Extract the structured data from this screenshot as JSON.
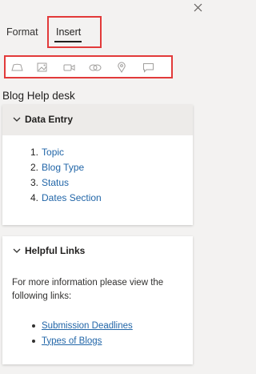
{
  "tabs": {
    "format_label": "Format",
    "insert_label": "Insert",
    "active": "Insert"
  },
  "toolbar": {
    "icons": [
      "cloud-shape-icon",
      "image-icon",
      "video-icon",
      "link-icon",
      "location-pin-icon",
      "comment-icon"
    ]
  },
  "section_title": "Blog Help desk",
  "data_entry": {
    "title": "Data Entry",
    "items": [
      {
        "num": "1.",
        "label": "Topic"
      },
      {
        "num": "2.",
        "label": "Blog Type"
      },
      {
        "num": "3.",
        "label": "Status"
      },
      {
        "num": "4.",
        "label": "Dates Section"
      }
    ]
  },
  "helpful_links": {
    "title": "Helpful Links",
    "text": "For more information please view the following links:",
    "links": [
      "Submission Deadlines",
      "Types of Blogs"
    ]
  },
  "colors": {
    "highlight": "#e23a3a",
    "link": "#2266a8",
    "panel_bg": "#f3f2f1"
  }
}
